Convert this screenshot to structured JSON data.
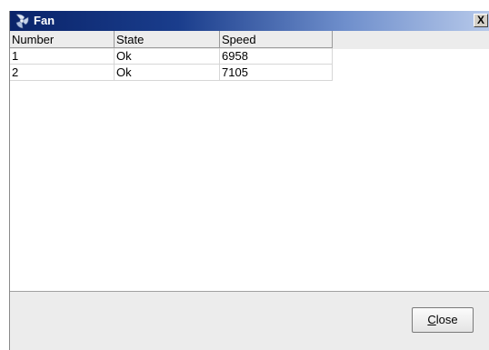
{
  "window": {
    "title": "Fan",
    "close_glyph": "X",
    "icon": "fan-icon"
  },
  "table": {
    "columns": [
      "Number",
      "State",
      "Speed"
    ],
    "rows": [
      [
        "1",
        "Ok",
        "6958"
      ],
      [
        "2",
        "Ok",
        "7105"
      ]
    ]
  },
  "footer": {
    "close_mnemonic": "C",
    "close_rest": "lose"
  },
  "colors": {
    "titlebar_start": "#0a246a",
    "titlebar_end": "#b7c9ea",
    "dialog_bg": "#ececec"
  }
}
